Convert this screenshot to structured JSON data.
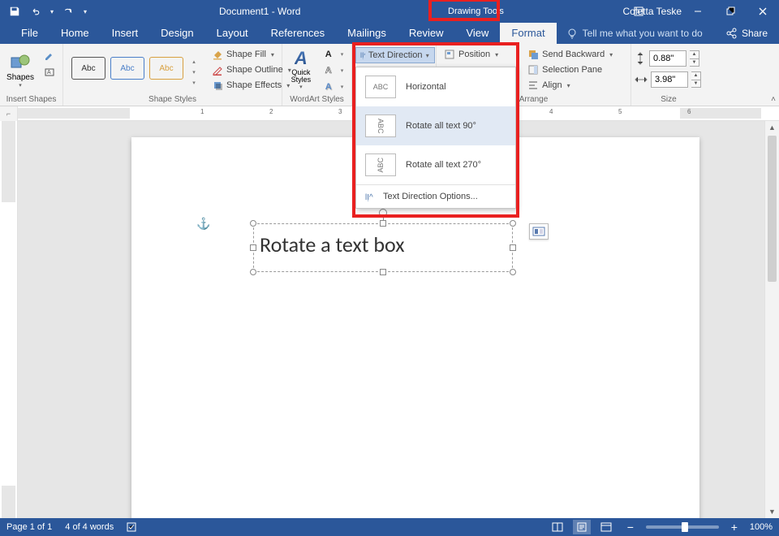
{
  "titlebar": {
    "doc_title": "Document1 - Word",
    "tool_tab": "Drawing Tools",
    "username": "Coletta Teske"
  },
  "tabs": {
    "file": "File",
    "home": "Home",
    "insert": "Insert",
    "design": "Design",
    "layout": "Layout",
    "references": "References",
    "mailings": "Mailings",
    "review": "Review",
    "view": "View",
    "format": "Format",
    "tellme_placeholder": "Tell me what you want to do",
    "share": "Share"
  },
  "ribbon": {
    "insert_shapes": {
      "label": "Insert Shapes",
      "shapes_btn": "Shapes"
    },
    "shape_styles": {
      "label": "Shape Styles",
      "sample": "Abc",
      "fill": "Shape Fill",
      "outline": "Shape Outline",
      "effects": "Shape Effects"
    },
    "wordart_styles": {
      "label": "WordArt Styles",
      "quick_styles": "Quick Styles"
    },
    "text": {
      "text_direction_btn": "Text Direction",
      "menu": {
        "horizontal": "Horizontal",
        "rotate90": "Rotate all text 90°",
        "rotate270": "Rotate all text 270°",
        "options": "Text Direction Options...",
        "preview_abc": "ABC"
      }
    },
    "arrange": {
      "label": "Arrange",
      "position": "Position",
      "send_backward": "Send Backward",
      "selection_pane": "Selection Pane",
      "align": "Align"
    },
    "size": {
      "label": "Size",
      "height": "0.88\"",
      "width": "3.98\""
    }
  },
  "document": {
    "textbox_content": "Rotate a text box"
  },
  "status": {
    "page": "Page 1 of 1",
    "words": "4 of 4 words",
    "zoom": "100%"
  }
}
